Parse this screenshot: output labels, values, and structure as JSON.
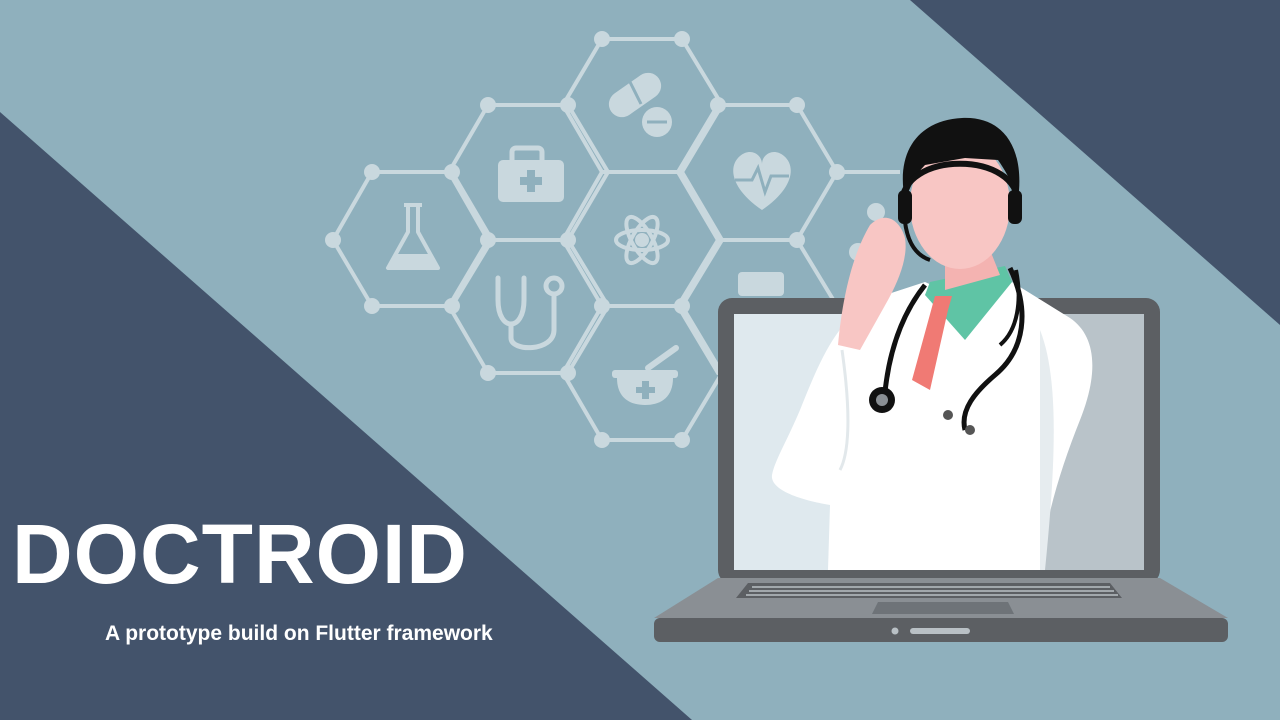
{
  "slide": {
    "title": "DOCTROID",
    "subtitle": "A prototype build on Flutter framework"
  },
  "colors": {
    "background": "#8fb0bd",
    "dark_band": "#43536b",
    "icon_stroke": "#c9d8de",
    "laptop_body": "#8a8f94",
    "laptop_frame": "#5c5f63",
    "coat": "#ffffff",
    "skin": "#f8c6c4",
    "shirt": "#5fc4a5",
    "tie": "#f07a74",
    "hair": "#111111"
  },
  "icons": [
    "pill-icon",
    "first-aid-kit-icon",
    "heart-pulse-icon",
    "flask-icon",
    "atom-icon",
    "stethoscope-icon",
    "mortar-icon"
  ]
}
